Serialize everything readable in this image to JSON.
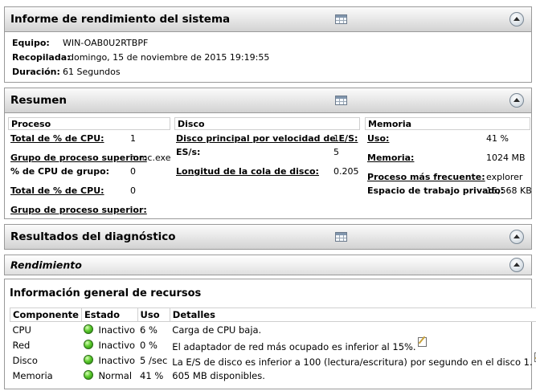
{
  "report": {
    "title": "Informe de rendimiento del sistema",
    "rows": [
      {
        "label": "Equipo:",
        "value": "WIN-OAB0U2RTBPF"
      },
      {
        "label": "Recopilada:",
        "value": "domingo, 15 de noviembre de 2015 19:19:55"
      },
      {
        "label": "Duración:",
        "value": "61 Segundos"
      }
    ]
  },
  "summary": {
    "title": "Resumen",
    "process": {
      "header": "Proceso",
      "rows": [
        {
          "label": "Total de % de CPU:",
          "value": "1"
        },
        {
          "label": "Grupo de proceso superior:",
          "value": "mmc.exe"
        },
        {
          "label": "% de CPU de grupo:",
          "value": "0"
        },
        {
          "label": "Total de % de CPU:",
          "value": "0"
        },
        {
          "label": "Grupo de proceso superior:",
          "value": ""
        }
      ]
    },
    "disk": {
      "header": "Disco",
      "rows": [
        {
          "label": "Disco principal por velocidad de E/S:",
          "value": "1"
        },
        {
          "label": "ES/s:",
          "value": "5"
        },
        {
          "label": "Longitud de la cola de disco:",
          "value": "0.205"
        }
      ]
    },
    "memory": {
      "header": "Memoria",
      "rows": [
        {
          "label": "Uso:",
          "value": "41 %"
        },
        {
          "label": "Memoria:",
          "value": "1024 MB"
        },
        {
          "label": "Proceso más frecuente:",
          "value": "explorer"
        },
        {
          "label": "Espacio de trabajo privado:",
          "value": "15,568 KB"
        }
      ]
    }
  },
  "diagnostics": {
    "title": "Resultados del diagnóstico"
  },
  "performance": {
    "title": "Rendimiento"
  },
  "resources": {
    "title": "Información general de recursos",
    "columns": [
      "Componente",
      "Estado",
      "Uso",
      "Detalles"
    ],
    "rows": [
      {
        "component": "CPU",
        "status": "Inactivo",
        "usage": "6 %",
        "details": "Carga de CPU baja."
      },
      {
        "component": "Red",
        "status": "Inactivo",
        "usage": "0 %",
        "details": "El adaptador de red más ocupado es inferior al 15%."
      },
      {
        "component": "Disco",
        "status": "Inactivo",
        "usage": "5 /sec",
        "details": "La E/S de disco es inferior a 100 (lectura/escritura) por segundo en el disco 1."
      },
      {
        "component": "Memoria",
        "status": "Normal",
        "usage": "41 %",
        "details": "605 MB disponibles."
      }
    ]
  },
  "colors": {
    "status_ok": "#3cb521",
    "border": "#9a9a9a"
  }
}
